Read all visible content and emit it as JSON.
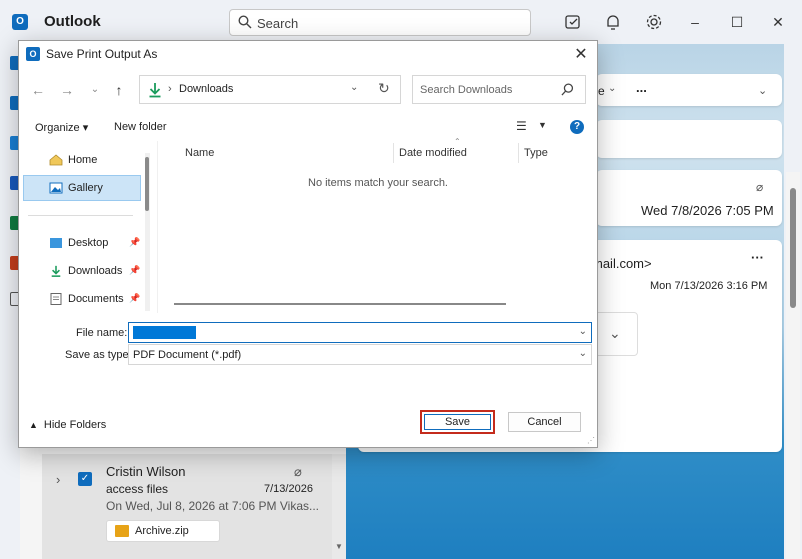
{
  "app": {
    "title": "Outlook",
    "search_placeholder": "Search"
  },
  "reading_pane": {
    "sender_email_fragment": "mail.com>",
    "date_top": "Wed 7/8/2026 7:05 PM",
    "date_second": "Mon 7/13/2026 3:16 PM",
    "dropdown_fragment": "e",
    "more_label": "..."
  },
  "mail_item": {
    "sender": "Cristin Wilson",
    "subject": "access files",
    "date": "7/13/2026",
    "preview": "On Wed, Jul 8, 2026 at 7:06 PM Vikas...",
    "attachment": "Archive.zip"
  },
  "dialog": {
    "title": "Save Print Output As",
    "address_path": "Downloads",
    "search_placeholder": "Search Downloads",
    "toolbar": {
      "organize": "Organize",
      "new_folder": "New folder"
    },
    "nav": {
      "home": "Home",
      "gallery": "Gallery",
      "desktop": "Desktop",
      "downloads": "Downloads",
      "documents": "Documents"
    },
    "columns": {
      "name": "Name",
      "date_modified": "Date modified",
      "type": "Type"
    },
    "empty_message": "No items match your search.",
    "file_name_label": "File name:",
    "file_name_value": "",
    "save_as_type_label": "Save as type:",
    "save_as_type_value": "PDF Document (*.pdf)",
    "hide_folders": "Hide Folders",
    "save_button": "Save",
    "cancel_button": "Cancel"
  },
  "colors": {
    "accent": "#0f6cbd",
    "highlight": "#c42b1c",
    "selection": "#cce4f7"
  }
}
